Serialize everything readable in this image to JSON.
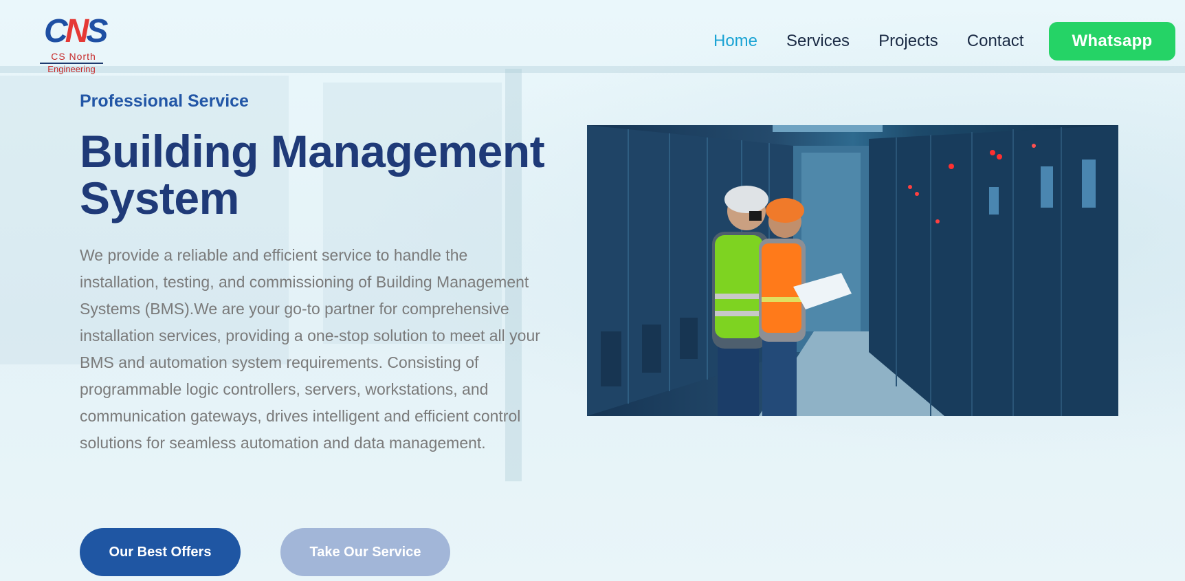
{
  "brand": {
    "logo_mark_c": "C",
    "logo_mark_n": "N",
    "logo_mark_s": "S",
    "name_line1": "CS North",
    "name_line2": "Engineering",
    "colors": {
      "primary_blue": "#1f56a3",
      "accent_red": "#e53935"
    }
  },
  "nav": {
    "items": [
      {
        "label": "Home",
        "active": true
      },
      {
        "label": "Services",
        "active": false
      },
      {
        "label": "Projects",
        "active": false
      },
      {
        "label": "Contact",
        "active": false
      }
    ],
    "active_color": "#1aa3d4",
    "whatsapp_label": "Whatsapp",
    "whatsapp_color": "#25d366"
  },
  "hero": {
    "eyebrow": "Professional Service",
    "title_line1": "Building Management",
    "title_line2": "System",
    "description": "We provide a reliable and efficient service to handle the installation, testing, and commissioning of Building Management Systems (BMS).We are your go-to partner for comprehensive installation services, providing a one-stop solution to meet all your BMS and automation system requirements. Consisting of programmable logic controllers, servers, workstations, and communication gateways, drives intelligent and efficient control solutions for seamless automation and data management.",
    "primary_cta": "Our Best Offers",
    "secondary_cta": "Take Our Service",
    "image_icon": "engineers-control-room-photo"
  }
}
